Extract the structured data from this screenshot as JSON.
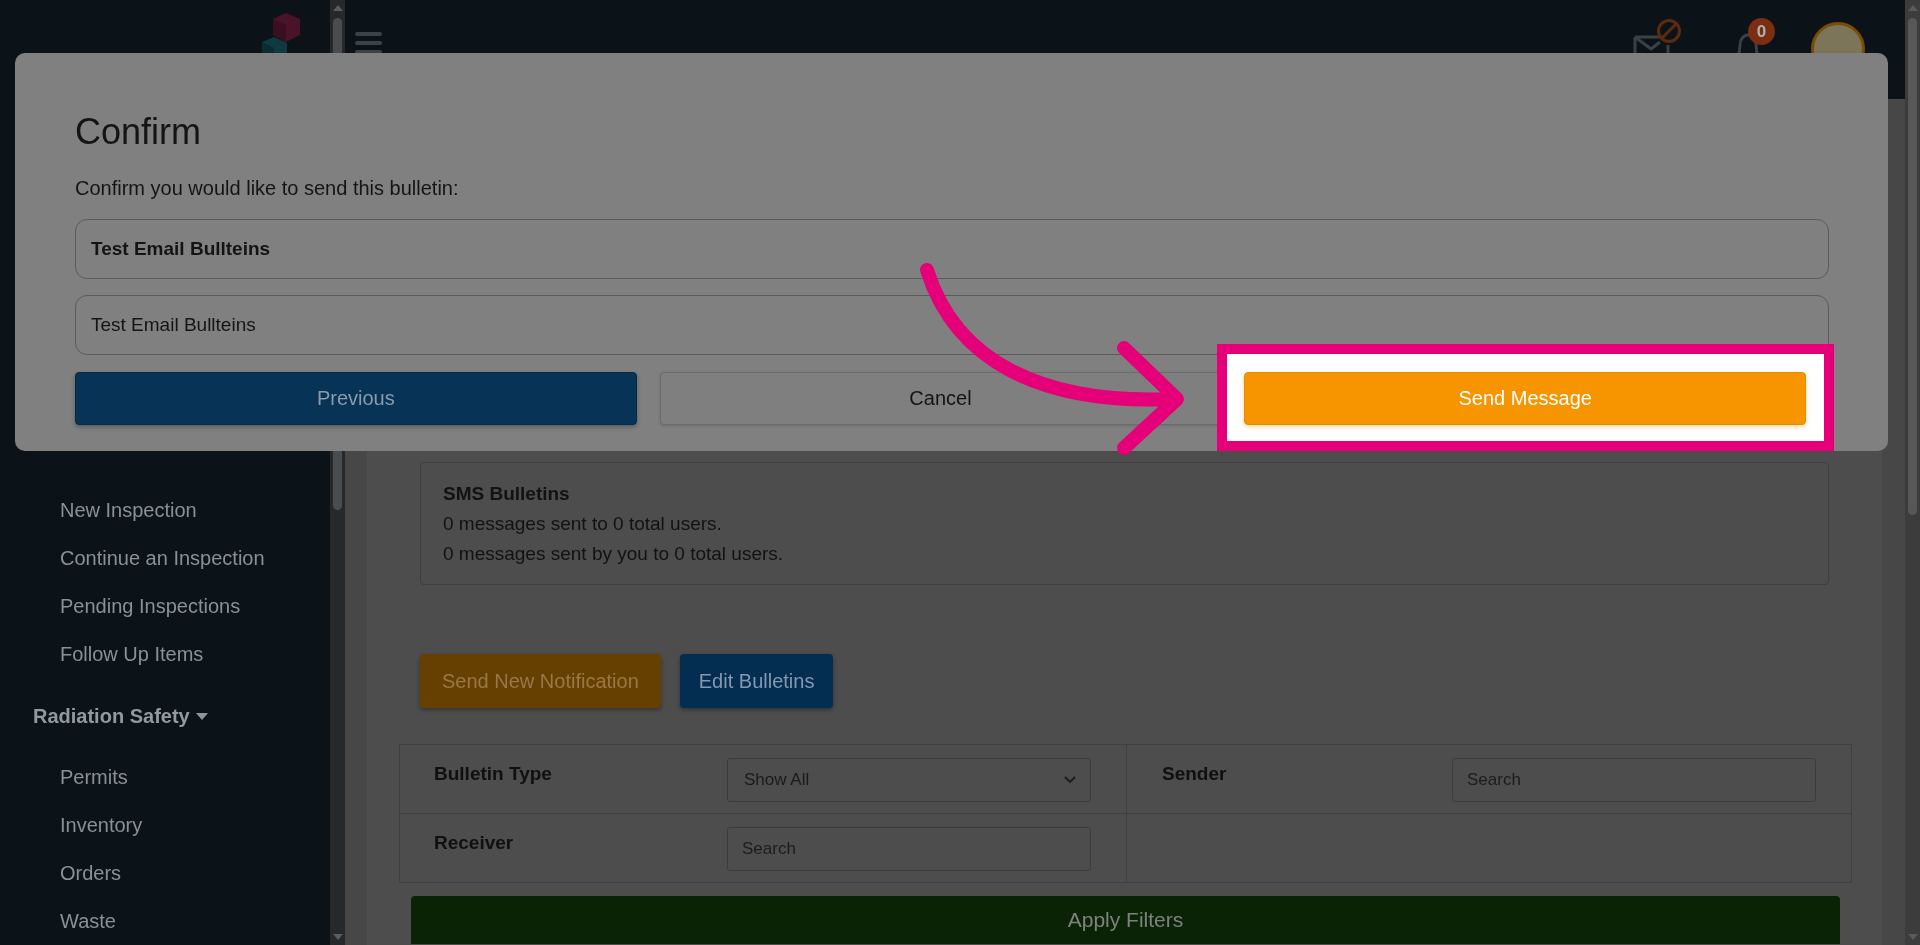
{
  "top_bar": {
    "notification_count": "0"
  },
  "sidebar": {
    "sections": [
      {
        "items": [
          "New Inspection",
          "Continue an Inspection",
          "Pending Inspections",
          "Follow Up Items"
        ]
      },
      {
        "title": "Radiation Safety",
        "expanded": true,
        "items": [
          "Permits",
          "Inventory",
          "Orders",
          "Waste"
        ]
      }
    ]
  },
  "sms_summary": {
    "title": "SMS Bulletins",
    "lines": [
      "0 messages sent to 0 total users.",
      "0 messages sent by you to 0 total users."
    ]
  },
  "actions": [
    {
      "label": "Send New Notification",
      "kind": "warning"
    },
    {
      "label": "Edit Bulletins",
      "kind": "primary"
    }
  ],
  "filters": {
    "fields": [
      {
        "label": "Bulletin Type",
        "kind": "select",
        "value": "Show All"
      },
      {
        "label": "Sender",
        "kind": "search",
        "placeholder": "Search"
      },
      {
        "label": "Receiver",
        "kind": "search",
        "placeholder": "Search"
      }
    ],
    "apply_button": "Apply Filters"
  },
  "dialog": {
    "title": "Confirm",
    "message": "Confirm you would like to send this bulletin:",
    "subject": "Test Email Bullteins",
    "body": "Test Email Bullteins",
    "buttons": [
      {
        "label": "Previous",
        "kind": "primary",
        "highlighted": false
      },
      {
        "label": "Cancel",
        "kind": "secondary",
        "highlighted": false
      },
      {
        "label": "Send Message",
        "kind": "warning",
        "highlighted": true
      }
    ]
  }
}
